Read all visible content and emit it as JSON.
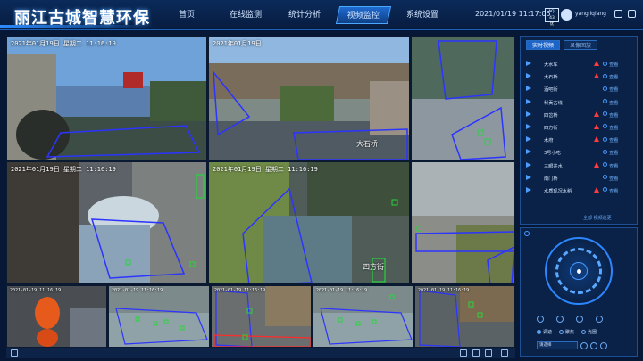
{
  "header": {
    "title": "丽江古城智慧环保",
    "nav": [
      "首页",
      "在线监测",
      "统计分析",
      "视频监控",
      "系统设置"
    ],
    "active_nav": 3,
    "datetime": "2021/01/19 11:17:05",
    "aqi": [
      "AQI",
      "43",
      "优"
    ],
    "username": "yangliqiang"
  },
  "cameras": {
    "main": [
      {
        "timestamp": "2021年01月19日 星期二 11:16:19",
        "name": ""
      },
      {
        "timestamp": "2021年01月19日",
        "name": "大石桥"
      },
      {
        "timestamp": "",
        "name": ""
      },
      {
        "timestamp": "2021年01月19日 星期二 11:16:19",
        "name": ""
      },
      {
        "timestamp": "2021年01月19日 星期二 11:16:19",
        "name": "四方街"
      },
      {
        "timestamp": "",
        "name": ""
      }
    ],
    "small": [
      {
        "timestamp": "2021-01-19 11:16:19"
      },
      {
        "timestamp": "2021-01-19 11:16:19"
      },
      {
        "timestamp": "2021-01-19 11:16:19"
      },
      {
        "timestamp": "2021-01-19 11:16:19"
      },
      {
        "timestamp": "2021-01-19 11:16:19"
      }
    ]
  },
  "panel": {
    "tabs": [
      "实时视频",
      "录像回放"
    ],
    "view_label": "查看",
    "footer": "全部   视频巡更",
    "cameras": [
      {
        "name": "大水车",
        "alert": true
      },
      {
        "name": "大石桥",
        "alert": true
      },
      {
        "name": "酒吧街",
        "alert": false
      },
      {
        "name": "科贡古线",
        "alert": false
      },
      {
        "name": "四岔桥",
        "alert": true
      },
      {
        "name": "四方街",
        "alert": true
      },
      {
        "name": "木府",
        "alert": true
      },
      {
        "name": "3号小吃",
        "alert": false
      },
      {
        "name": "三眼井水",
        "alert": true
      },
      {
        "name": "南门桥",
        "alert": false
      },
      {
        "name": "水质现况水稻",
        "alert": true
      }
    ]
  },
  "ptz": {
    "radios": [
      "调速",
      "聚焦",
      "光圈"
    ],
    "select": "请选择"
  }
}
